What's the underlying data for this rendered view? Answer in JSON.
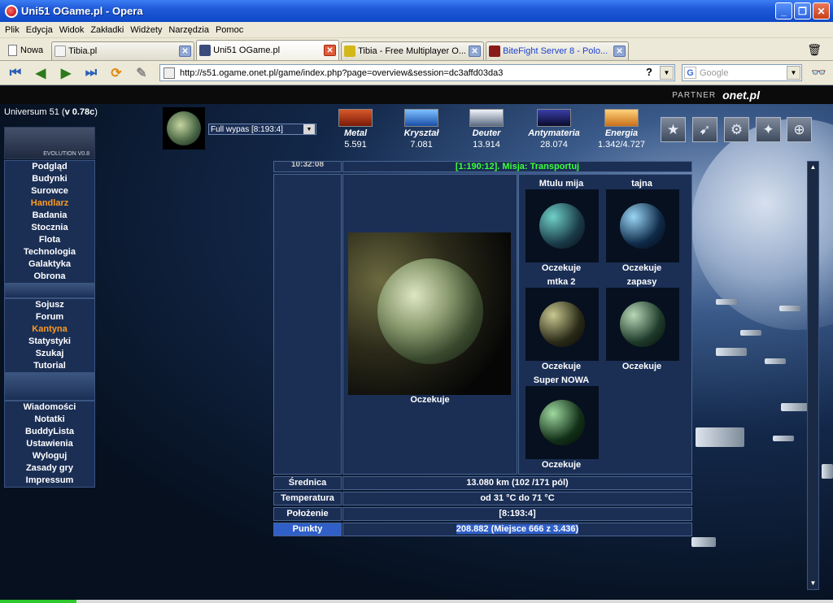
{
  "window": {
    "title": "Uni51 OGame.pl - Opera",
    "minimize": "_",
    "maximize": "❐",
    "close": "✕"
  },
  "menu": [
    "Plik",
    "Edycja",
    "Widok",
    "Zakładki",
    "Widżety",
    "Narzędzia",
    "Pomoc"
  ],
  "tabs": {
    "new_label": "Nowa",
    "items": [
      {
        "label": "Tibia.pl",
        "color": "#f4f4f4"
      },
      {
        "label": "Uni51 OGame.pl",
        "color": "#3a4c7a",
        "active": true
      },
      {
        "label": "Tibia - Free Multiplayer O...",
        "color": "#d4b81a"
      },
      {
        "label": "BiteFight Server 8 - Polo...",
        "color": "#8a1a1a"
      }
    ]
  },
  "address": {
    "url": "http://s51.ogame.onet.pl/game/index.php?page=overview&session=dc3affd03da3",
    "help": "?",
    "search_placeholder": "Google",
    "search_icon": "G"
  },
  "partner": {
    "label": "PARTNER",
    "brand": "onet.pl"
  },
  "game": {
    "universe_label": "Universum 51 (",
    "version": "v 0.78c",
    "universe_close": ")",
    "logo_text": "EVOLUTION V0.8",
    "planet_select": "Full wypas [8:193:4]",
    "resources": [
      {
        "name": "Metal",
        "value": "5.591",
        "color": "#b0401a"
      },
      {
        "name": "Kryształ",
        "value": "7.081",
        "color": "#3a7fd8"
      },
      {
        "name": "Deuter",
        "value": "13.914",
        "color": "#c8d0dc"
      },
      {
        "name": "Antymateria",
        "value": "28.074",
        "color": "#1a2060"
      },
      {
        "name": "Energia",
        "value": "1.342/4.727",
        "color": "#f0a02a"
      }
    ],
    "action_icons": [
      "star-icon",
      "ship-icon",
      "officer-icon",
      "research-icon",
      "target-icon"
    ],
    "menu1": [
      "Podgląd",
      "Budynki",
      "Surowce",
      "Handlarz",
      "Badania",
      "Stocznia",
      "Flota",
      "Technologia",
      "Galaktyka",
      "Obrona"
    ],
    "menu2": [
      "Sojusz",
      "Forum",
      "Kantyna",
      "Statystyki",
      "Szukaj",
      "Tutorial"
    ],
    "menu3": [
      "Wiadomości",
      "Notatki",
      "BuddyLista",
      "Ustawienia",
      "Wyloguj",
      "Zasady gry",
      "Impressum"
    ],
    "time_cell": "10:32:08",
    "mission": "[1:190:12]. Misja: Transportuj",
    "main_planet_status": "Oczekuje",
    "moons": [
      {
        "name": "Mtulu mija",
        "status": "Oczekuje",
        "c1": "#6fd0c8",
        "c2": "#1a3a48"
      },
      {
        "name": "tajna",
        "status": "Oczekuje",
        "c1": "#9ad6f5",
        "c2": "#0e2a48"
      },
      {
        "name": "mtka 2",
        "status": "Oczekuje",
        "c1": "#c8c890",
        "c2": "#2a2a18"
      },
      {
        "name": "zapasy",
        "status": "Oczekuje",
        "c1": "#b8d8b8",
        "c2": "#1e3a2a"
      },
      {
        "name": "Super NOWA",
        "status": "Oczekuje",
        "c1": "#9fd8a0",
        "c2": "#123018"
      }
    ],
    "stats": [
      {
        "key": "Średnica",
        "value": "13.080 km (102 /171 pól)"
      },
      {
        "key": "Temperatura",
        "value": "od 31 °C do 71 °C"
      },
      {
        "key": "Położenie",
        "value": "[8:193:4]"
      },
      {
        "key": "Punkty",
        "value": "208.882 (Miejsce 666 z 3.436)"
      }
    ]
  }
}
